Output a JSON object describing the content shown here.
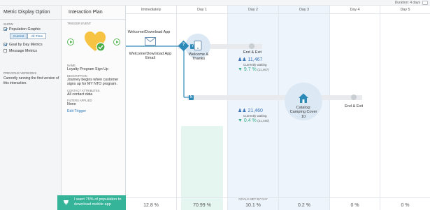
{
  "topbar": {
    "duration": "Duration: 4 days"
  },
  "left_panel": {
    "title": "Metric Display Option",
    "show_label": "SHOW",
    "options": [
      {
        "label": "Population Graphic",
        "checked": true
      },
      {
        "label": "Goal by Day Metrics",
        "checked": true
      },
      {
        "label": "Message Metrics",
        "checked": false
      }
    ],
    "toggle": {
      "current": "Current",
      "all_time": "All-Time"
    },
    "previous_versions_label": "PREVIOUS VERSIONS",
    "previous_versions_text": "Currently running the first version of this interaction."
  },
  "plan": {
    "title": "Interaction Plan",
    "trigger_label": "TRIGGER EVENT",
    "name_label": "NAME",
    "name_value": "Loyalty Program Sign Up",
    "description_label": "DESCRIPTION",
    "description_value": "Journey begins when customer signs up for MY NTO program.",
    "contact_label": "CONTACT ATTRIBUTES",
    "contact_value": "All contact data",
    "filters_label": "FILTERS APPLIED",
    "filters_value": "None",
    "edit_trigger": "Edit Trigger"
  },
  "columns": [
    {
      "label": "Immediately",
      "pct": "12.8 %",
      "bar": 0
    },
    {
      "label": "Day 1",
      "pct": "70.99 %",
      "bar": 0.6
    },
    {
      "label": "Day 2",
      "pct": "10.1 %",
      "bar": 0
    },
    {
      "label": "Day 3",
      "pct": "0.2 %",
      "bar": 0
    },
    {
      "label": "Day 4",
      "pct": "0 %",
      "bar": 0
    },
    {
      "label": "Day 5",
      "pct": "0 %",
      "bar": 0
    }
  ],
  "goals_by_day": "GOALS MET BY DAY",
  "flow": {
    "welcome_email_top": "Welcome/Download App",
    "welcome_email_label": "Welcome/Download App Email",
    "welcome_thanks": "Welcome & Thanks",
    "end_exit_1": "End & Exit",
    "waiting_1": "11,467",
    "waiting_text": "Currently waiting",
    "goal_1_pct": "9.7 %",
    "goal_1_count": "(11,467)",
    "waiting_2": "21,460",
    "goal_2_pct": "0.4 %",
    "goal_2_count": "(21,460)",
    "catalog": "Catalog: Camping Cover 10",
    "end_exit_2": "End & Exit",
    "decision_yes": "Y",
    "decision_no": "N",
    "decision_q": "?"
  },
  "goal_banner": "I want 75% of population to download mobile app",
  "colors": {
    "accent": "#2d8ab8",
    "goal": "#35b49a",
    "highlight": "#edf4fb"
  }
}
